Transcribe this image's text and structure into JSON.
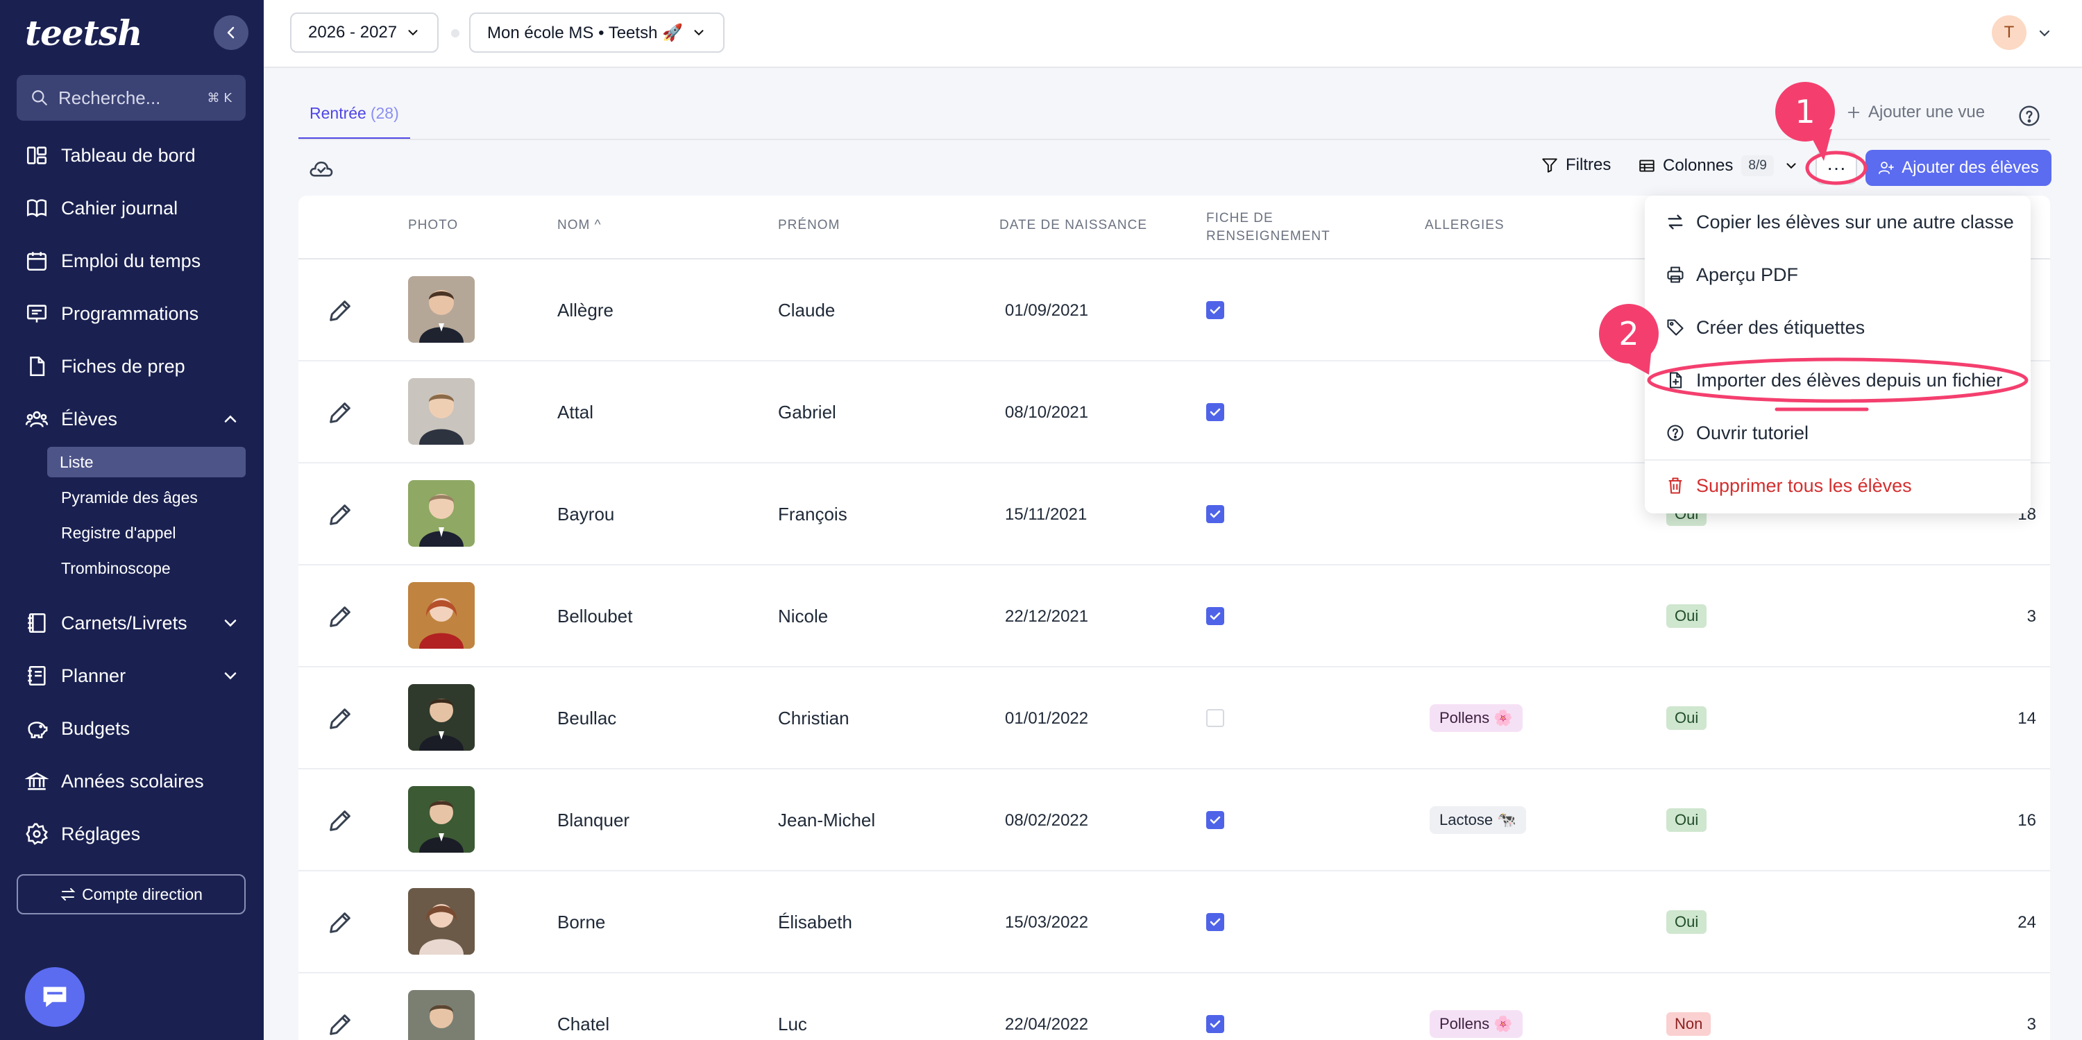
{
  "app": {
    "logo": "teetsh",
    "search_placeholder": "Recherche...",
    "search_shortcut": "⌘ K"
  },
  "sidebar": {
    "items": [
      {
        "label": "Tableau de bord",
        "icon": "dashboard-icon"
      },
      {
        "label": "Cahier journal",
        "icon": "book-icon"
      },
      {
        "label": "Emploi du temps",
        "icon": "calendar-icon"
      },
      {
        "label": "Programmations",
        "icon": "presentation-icon"
      },
      {
        "label": "Fiches de prep",
        "icon": "file-icon"
      },
      {
        "label": "Élèves",
        "icon": "users-icon",
        "expanded": true
      },
      {
        "label": "Carnets/Livrets",
        "icon": "notebook-icon"
      },
      {
        "label": "Planner",
        "icon": "planner-icon"
      },
      {
        "label": "Budgets",
        "icon": "piggy-bank-icon"
      },
      {
        "label": "Années scolaires",
        "icon": "bank-icon"
      },
      {
        "label": "Réglages",
        "icon": "gear-icon"
      }
    ],
    "sub_items": [
      "Liste",
      "Pyramide des âges",
      "Registre d'appel",
      "Trombinoscope"
    ],
    "active_sub": "Liste",
    "account_button": "Compte direction"
  },
  "topbar": {
    "year": "2026 - 2027",
    "school": "Mon école MS • Teetsh 🚀",
    "avatar_initial": "T"
  },
  "tabs": [
    {
      "label": "Rentrée",
      "count": "(28)"
    }
  ],
  "toolbar": {
    "add_view": "Ajouter une vue",
    "filters": "Filtres",
    "columns": "Colonnes",
    "columns_count": "8/9",
    "more": "···",
    "add_students": "Ajouter des élèves"
  },
  "table": {
    "headers": {
      "photo": "PHOTO",
      "nom": "NOM",
      "prenom": "PRÉNOM",
      "naissance": "DATE DE NAISSANCE",
      "fiche_l1": "FICHE DE",
      "fiche_l2": "RENSEIGNEMENT",
      "allergies": "ALLERGIES"
    },
    "rows": [
      {
        "nom": "Allègre",
        "prenom": "Claude",
        "date": "01/09/2021",
        "fiche": true,
        "allergie": "",
        "statut": "",
        "num": ""
      },
      {
        "nom": "Attal",
        "prenom": "Gabriel",
        "date": "08/10/2021",
        "fiche": true,
        "allergie": "",
        "statut": "",
        "num": ""
      },
      {
        "nom": "Bayrou",
        "prenom": "François",
        "date": "15/11/2021",
        "fiche": true,
        "allergie": "",
        "statut": "Oui",
        "num": "18"
      },
      {
        "nom": "Belloubet",
        "prenom": "Nicole",
        "date": "22/12/2021",
        "fiche": true,
        "allergie": "",
        "statut": "Oui",
        "num": "3"
      },
      {
        "nom": "Beullac",
        "prenom": "Christian",
        "date": "01/01/2022",
        "fiche": false,
        "allergie": "Pollens 🌸",
        "statut": "Oui",
        "num": "14"
      },
      {
        "nom": "Blanquer",
        "prenom": "Jean-Michel",
        "date": "08/02/2022",
        "fiche": true,
        "allergie": "Lactose 🐄",
        "statut": "Oui",
        "num": "16"
      },
      {
        "nom": "Borne",
        "prenom": "Élisabeth",
        "date": "15/03/2022",
        "fiche": true,
        "allergie": "",
        "statut": "Oui",
        "num": "24"
      },
      {
        "nom": "Chatel",
        "prenom": "Luc",
        "date": "22/04/2022",
        "fiche": true,
        "allergie": "Pollens 🌸",
        "statut": "Non",
        "num": "3"
      }
    ]
  },
  "menu": {
    "items": [
      {
        "label": "Copier les élèves sur une autre classe",
        "icon": "swap-icon"
      },
      {
        "label": "Aperçu PDF",
        "icon": "printer-icon"
      },
      {
        "label": "Créer des étiquettes",
        "icon": "tag-icon"
      },
      {
        "label": "Importer des élèves depuis un fichier",
        "icon": "file-import-icon"
      },
      {
        "label": "Ouvrir tutoriel",
        "icon": "help-circle-icon"
      },
      {
        "label": "Supprimer tous les élèves",
        "icon": "trash-icon"
      }
    ]
  },
  "annotations": {
    "step1": "1",
    "step2": "2",
    "color": "#f43f6e"
  }
}
